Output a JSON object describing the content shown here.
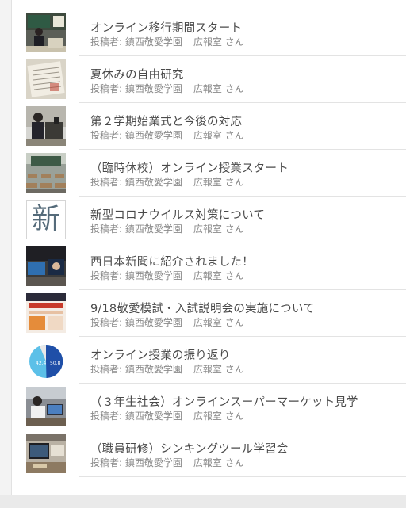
{
  "posts": [
    {
      "title": "オンライン移行期間スタート",
      "author_prefix": "投稿者:",
      "author": "鎮西敬愛学園",
      "author_dept": "広報室 さん",
      "thumb_icon": "classroom-teacher-photo"
    },
    {
      "title": "夏休みの自由研究",
      "author_prefix": "投稿者:",
      "author": "鎮西敬愛学園",
      "author_dept": "広報室 さん",
      "thumb_icon": "notebook-photo"
    },
    {
      "title": "第２学期始業式と今後の対応",
      "author_prefix": "投稿者:",
      "author": "鎮西敬愛学園",
      "author_dept": "広報室 さん",
      "thumb_icon": "speaker-podium-photo"
    },
    {
      "title": "（臨時休校）オンライン授業スタート",
      "author_prefix": "投稿者:",
      "author": "鎮西敬愛学園",
      "author_dept": "広報室 さん",
      "thumb_icon": "empty-classroom-photo"
    },
    {
      "title": "新型コロナウイルス対策について",
      "author_prefix": "投稿者:",
      "author": "鎮西敬愛学園",
      "author_dept": "広報室 さん",
      "thumb_icon": "kanji-new-icon",
      "thumb_text": "新"
    },
    {
      "title": "西日本新聞に紹介されました！",
      "author_prefix": "投稿者:",
      "author": "鎮西敬愛学園",
      "author_dept": "広報室 さん",
      "thumb_icon": "screen-lecture-photo"
    },
    {
      "title": "9/18敬愛模試・入試説明会の実施について",
      "author_prefix": "投稿者:",
      "author": "鎮西敬愛学園",
      "author_dept": "広報室 さん",
      "thumb_icon": "flyer-photo"
    },
    {
      "title": "オンライン授業の振り返り",
      "author_prefix": "投稿者:",
      "author": "鎮西敬愛学園",
      "author_dept": "広報室 さん",
      "thumb_icon": "pie-chart-thumbnail",
      "thumb_values": [
        "42.4",
        "50.8"
      ]
    },
    {
      "title": "（３年生社会）オンラインスーパーマーケット見学",
      "author_prefix": "投稿者:",
      "author": "鎮西敬愛学園",
      "author_dept": "広報室 さん",
      "thumb_icon": "students-laptops-photo"
    },
    {
      "title": "（職員研修）シンキングツール学習会",
      "author_prefix": "投稿者:",
      "author": "鎮西敬愛学園",
      "author_dept": "広報室 さん",
      "thumb_icon": "tablet-training-photo"
    }
  ],
  "colors": {
    "title_text": "#4a4a4a",
    "meta_text": "#8a8a8a",
    "divider": "#e3e3e3",
    "background": "#ffffff",
    "pie_blue": "#1f4fa8",
    "pie_cyan": "#5cc0e8"
  }
}
